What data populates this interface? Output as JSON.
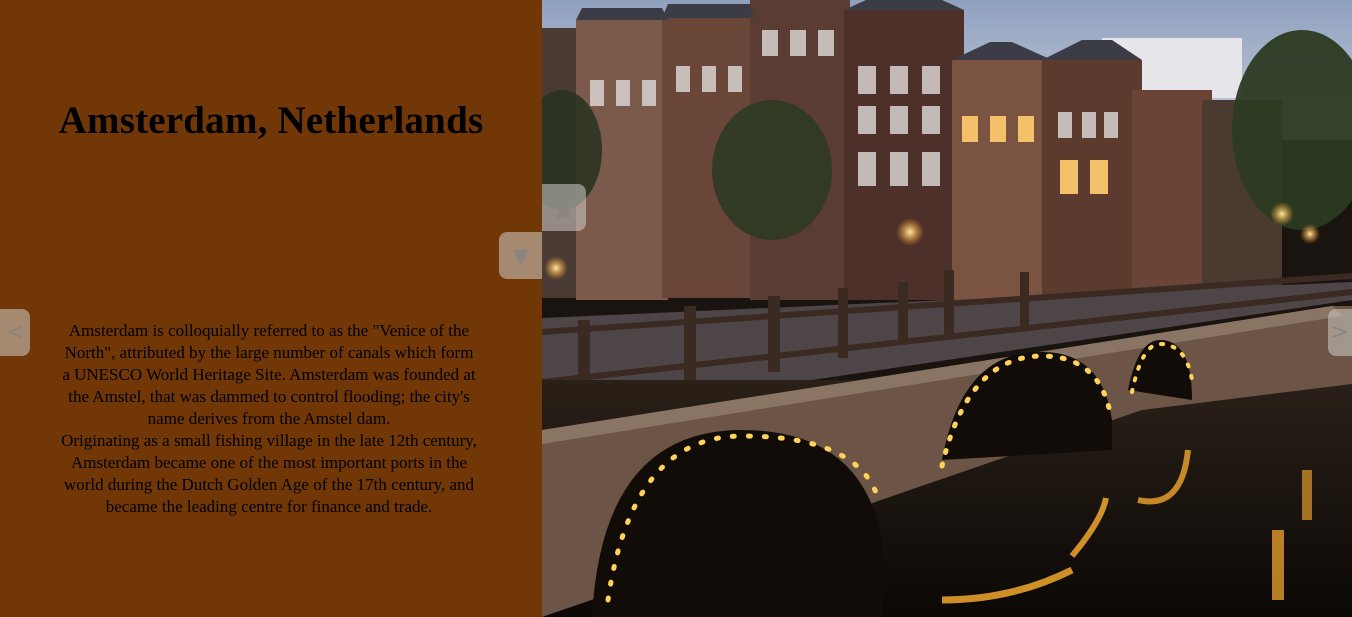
{
  "slide": {
    "title": "Amsterdam, Netherlands",
    "paragraphs": [
      "Amsterdam is colloquially referred to as the \"Venice of the North\", attributed by the large number of canals which form a UNESCO World Heritage Site. Amsterdam was founded at the Amstel, that was dammed to control flooding; the city's name derives from the Amstel dam.",
      "Originating as a small fishing village in the late 12th century, Amsterdam became one of the most important ports in the world during the Dutch Golden Age of the 17th century, and became the leading centre for finance and trade."
    ]
  },
  "controls": {
    "up_icon": "▲",
    "down_icon": "▼",
    "prev_icon": "<",
    "next_icon": ">"
  },
  "colors": {
    "panel_background": "#723707",
    "text": "#000000"
  }
}
